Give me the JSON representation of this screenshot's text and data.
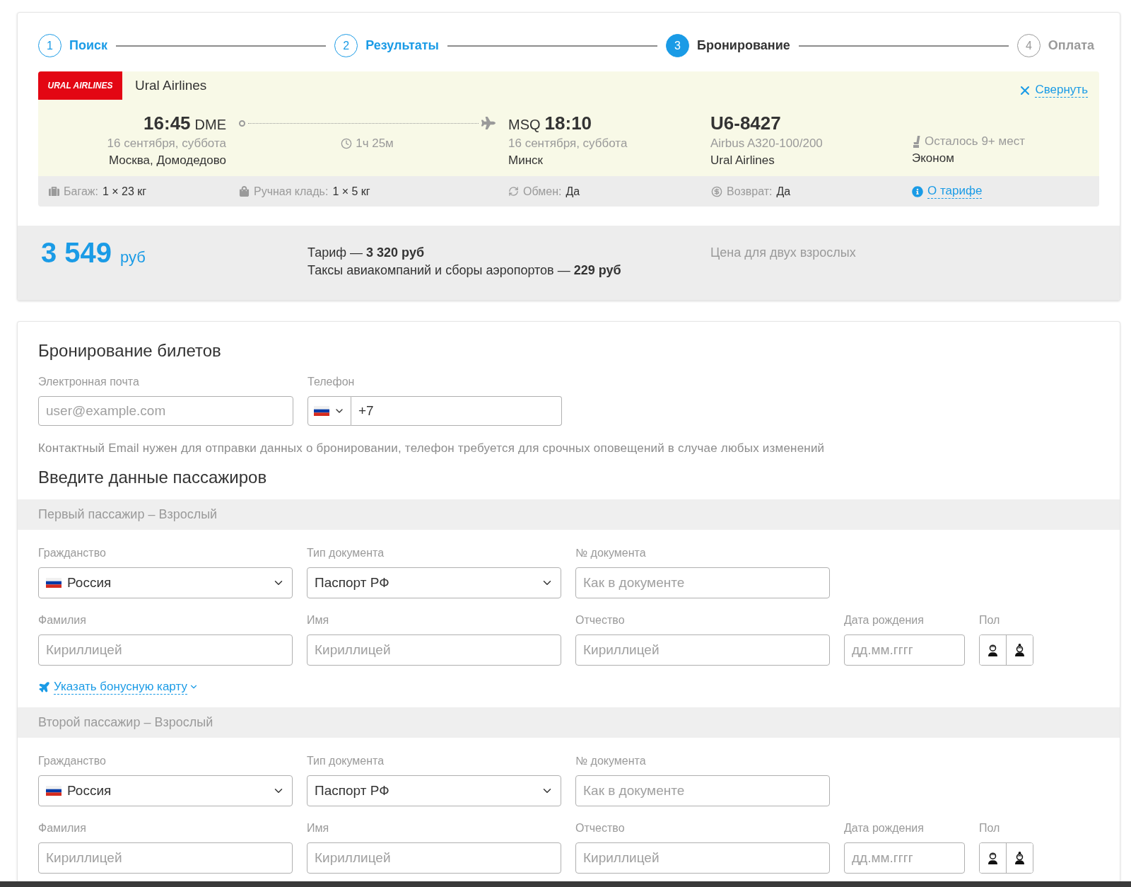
{
  "stepper": {
    "steps": [
      {
        "number": "1",
        "label": "Поиск",
        "completed": true,
        "selected": false
      },
      {
        "number": "2",
        "label": "Результаты",
        "completed": true,
        "selected": false
      },
      {
        "number": "3",
        "label": "Бронирование",
        "completed": false,
        "selected": true
      },
      {
        "number": "4",
        "label": "Оплата",
        "completed": false,
        "selected": false
      }
    ]
  },
  "flight": {
    "logo_text": "URAL AIRLINES",
    "airline": "Ural Airlines",
    "collapse_link": "Свернуть",
    "departure": {
      "time": "16:45",
      "airport": "DME",
      "date": "16 сентября, суббота",
      "city": "Москва, Домодедово"
    },
    "duration": "1ч 25м",
    "arrival": {
      "airport": "MSQ",
      "time": "18:10",
      "date": "16 сентября, суббота",
      "city": "Минск"
    },
    "flight_number": "U6-8427",
    "aircraft": "Airbus A320-100/200",
    "operator": "Ural Airlines",
    "seats_left": "Осталось 9+ мест",
    "cabin_class": "Эконом"
  },
  "conditions": [
    {
      "kind": "baggage",
      "label": "Багаж:",
      "value": "1 × 23 кг"
    },
    {
      "kind": "hand_luggage",
      "label": "Ручная кладь:",
      "value": "1 × 5 кг"
    },
    {
      "kind": "exchange",
      "label": "Обмен:",
      "value": "Да"
    },
    {
      "kind": "refund",
      "label": "Возврат:",
      "value": "Да"
    },
    {
      "kind": "fare_info",
      "label": "О тарифе"
    }
  ],
  "price": {
    "total": "3 549",
    "currency": "руб",
    "fare": "Тариф — **3 320 руб**",
    "taxes": "Таксы авиакомпаний и сборы аэропортов — **229 руб**",
    "note": "Цена для двух взрослых"
  },
  "booking": {
    "title": "Бронирование билетов",
    "email": {
      "label": "Электронная почта",
      "placeholder": "user@example.com"
    },
    "phone": {
      "label": "Телефон",
      "value": "+7"
    },
    "note": "Контактный Email нужен для отправки данных о бронировании, телефон требуется для срочных оповещений в случае любых изменений"
  },
  "passengers_title": "Введите данные пассажиров",
  "passengers": [
    {
      "header": "Первый пассажир – Взрослый",
      "rows": [
        [
          {
            "kind": "country_select",
            "label": "Гражданство",
            "value": "Россия"
          },
          {
            "kind": "select",
            "label": "Тип документа",
            "value": "Паспорт РФ"
          },
          {
            "kind": "text",
            "label": "№ документа",
            "placeholder": "Как в документе"
          }
        ],
        [
          {
            "kind": "text",
            "label": "Фамилия",
            "placeholder": "Кириллицей"
          },
          {
            "kind": "text",
            "label": "Имя",
            "placeholder": "Кириллицей"
          },
          {
            "kind": "text",
            "label": "Отчество",
            "placeholder": "Кириллицей"
          },
          {
            "kind": "date",
            "label": "Дата рождения",
            "placeholder": "дд.мм.гггг"
          },
          {
            "kind": "gender",
            "label": "Пол",
            "options": [
              {
                "kind": "male",
                "selected": false
              },
              {
                "kind": "female",
                "selected": false
              }
            ]
          }
        ]
      ],
      "bonus_link": "Указать бонусную карту"
    },
    {
      "header": "Второй пассажир – Взрослый",
      "rows": [
        [
          {
            "kind": "country_select",
            "label": "Гражданство",
            "value": "Россия"
          },
          {
            "kind": "select",
            "label": "Тип документа",
            "value": "Паспорт РФ"
          },
          {
            "kind": "text",
            "label": "№ документа",
            "placeholder": "Как в документе"
          }
        ],
        [
          {
            "kind": "text",
            "label": "Фамилия",
            "placeholder": "Кириллицей"
          },
          {
            "kind": "text",
            "label": "Имя",
            "placeholder": "Кириллицей"
          },
          {
            "kind": "text",
            "label": "Отчество",
            "placeholder": "Кириллицей"
          },
          {
            "kind": "date",
            "label": "Дата рождения",
            "placeholder": "дд.мм.гггг"
          },
          {
            "kind": "gender",
            "label": "Пол",
            "options": [
              {
                "kind": "male",
                "selected": false
              },
              {
                "kind": "female",
                "selected": false
              }
            ]
          }
        ]
      ]
    }
  ]
}
